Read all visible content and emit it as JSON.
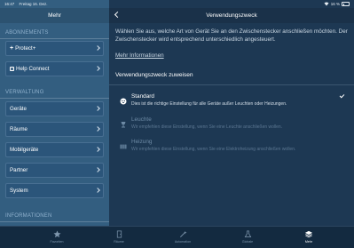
{
  "status_bar": {
    "time": "16:47",
    "date": "Freitag 16. Dez.",
    "battery": "16 %"
  },
  "sidebar": {
    "title": "Mehr",
    "sections": {
      "abonnements": "ABONNEMENTS",
      "verwaltung": "VERWALTUNG",
      "informationen": "INFORMATIONEN"
    },
    "subscriptions": [
      {
        "label": "Protect+"
      },
      {
        "label": "Help Connect"
      }
    ],
    "management": [
      {
        "label": "Geräte"
      },
      {
        "label": "Räume"
      },
      {
        "label": "Mobilgeräte"
      },
      {
        "label": "Partner"
      },
      {
        "label": "System"
      }
    ]
  },
  "main": {
    "title": "Verwendungszweck",
    "description": "Wählen Sie aus, welche Art von Gerät Sie an den Zwischenstecker anschließen möchten. Der Zwischenstecker wird entsprechend unterschiedlich angesteuert.",
    "more_info": "Mehr Informationen",
    "assign_title": "Verwendungszweck zuweisen",
    "options": [
      {
        "title": "Standard",
        "desc": "Dies ist die richtige Einstellung für alle Geräte außer Leuchten oder Heizungen.",
        "selected": true
      },
      {
        "title": "Leuchte",
        "desc": "Wir empfehlen diese Einstellung, wenn Sie eine Leuchte anschließen wollen.",
        "selected": false
      },
      {
        "title": "Heizung",
        "desc": "Wir empfehlen diese Einstellung, wenn Sie eine Elektroheizung anschließen wollen.",
        "selected": false
      }
    ]
  },
  "tabbar": {
    "tabs": [
      {
        "label": "Favoriten",
        "icon": "star-icon"
      },
      {
        "label": "Räume",
        "icon": "room-icon"
      },
      {
        "label": "Automation",
        "icon": "wand-icon"
      },
      {
        "label": "Globale",
        "icon": "flask-icon"
      },
      {
        "label": "Mehr",
        "icon": "layers-icon",
        "active": true
      }
    ]
  },
  "colors": {
    "sidebar_bg": "#335e80",
    "main_bg": "#1d3853",
    "tabbar_bg": "#132a40"
  }
}
